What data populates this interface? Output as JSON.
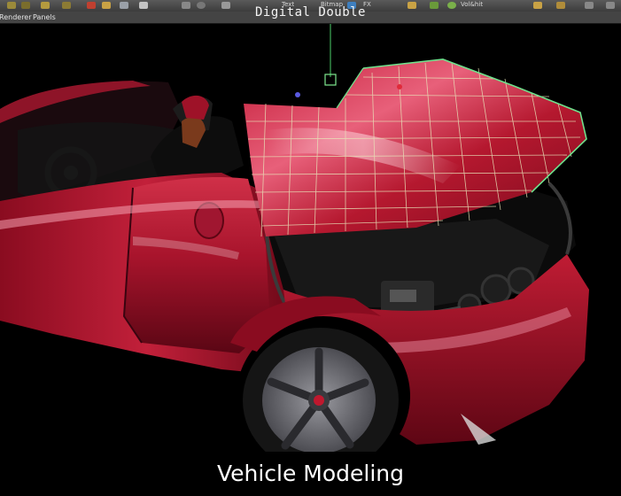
{
  "toolbar": {
    "items": [
      {
        "label": "Text"
      },
      {
        "label": "Bitmap"
      },
      {
        "label": "FX"
      },
      {
        "label": "Vol&hit"
      }
    ]
  },
  "menubar": {
    "items": [
      {
        "label": "Renderer"
      },
      {
        "label": "Panels"
      }
    ]
  },
  "viewport": {
    "panel_title": "Digital Double"
  },
  "caption": {
    "text": "Vehicle Modeling"
  },
  "colors": {
    "car_body": "#b0152e",
    "wireframe": "#e8e3b8",
    "selection": "#6fe08c",
    "tire": "#151515",
    "rim": "#6e6e72"
  }
}
